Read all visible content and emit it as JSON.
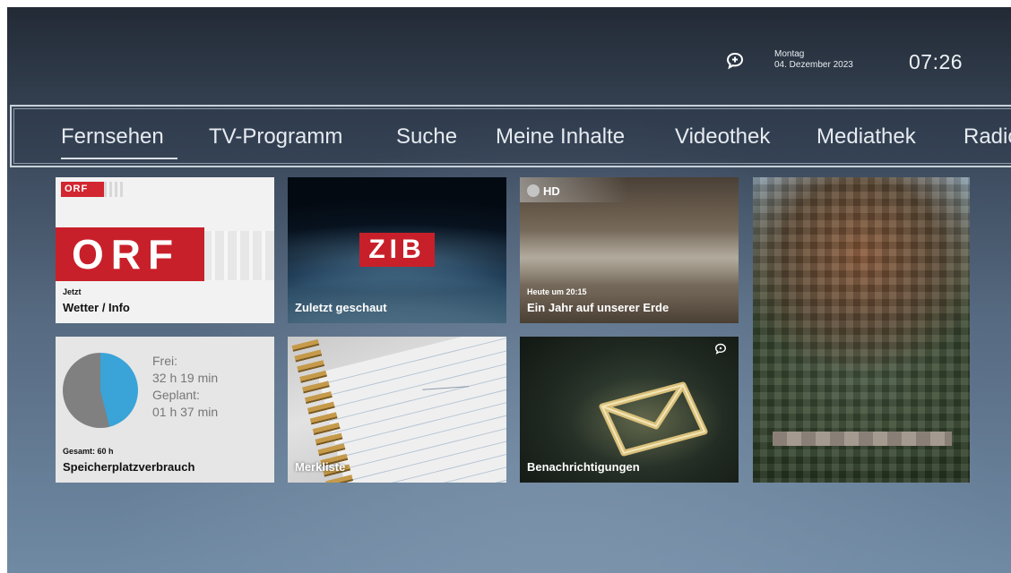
{
  "status": {
    "day": "Montag",
    "date": "04. Dezember 2023",
    "time": "07:26"
  },
  "nav": {
    "items": [
      {
        "label": "Fernsehen",
        "active": true
      },
      {
        "label": "TV-Programm"
      },
      {
        "label": "Suche"
      },
      {
        "label": "Meine Inhalte"
      },
      {
        "label": "Videothek"
      },
      {
        "label": "Mediathek"
      },
      {
        "label": "Radio"
      }
    ]
  },
  "tiles": {
    "orf": {
      "logo_small": "ORF",
      "logo_big": "ORF",
      "sublabel": "Jetzt",
      "label": "Wetter / Info"
    },
    "zib": {
      "logo": "ZIB",
      "label": "Zuletzt geschaut"
    },
    "doku": {
      "badge": "HD",
      "sublabel": "Heute um 20:15",
      "label": "Ein Jahr auf unserer Erde"
    },
    "storage": {
      "free_label": "Frei:",
      "free_value": "32 h 19 min",
      "planned_label": "Geplant:",
      "planned_value": "01 h 37 min",
      "total": "Gesamt: 60 h",
      "label": "Speicherplatzverbrauch",
      "used_fraction": 0.46,
      "color_used": "#3aa3d8",
      "color_free": "#808080"
    },
    "merkliste": {
      "label": "Merkliste"
    },
    "notifications": {
      "label": "Benachrichtigungen"
    }
  }
}
